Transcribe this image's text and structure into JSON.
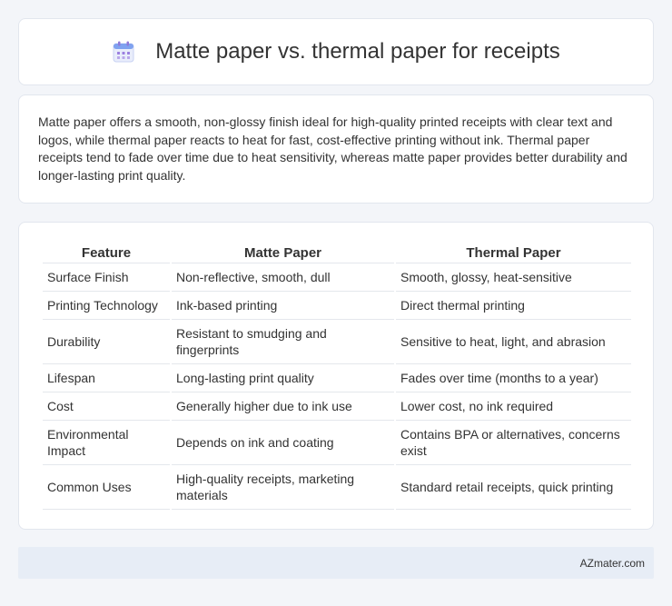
{
  "header": {
    "icon": "calendar-icon",
    "title": "Matte paper vs. thermal paper for receipts"
  },
  "summary": {
    "text": "Matte paper offers a smooth, non-glossy finish ideal for high-quality printed receipts with clear text and logos, while thermal paper reacts to heat for fast, cost-effective printing without ink. Thermal paper receipts tend to fade over time due to heat sensitivity, whereas matte paper provides better durability and longer-lasting print quality."
  },
  "table": {
    "headers": [
      "Feature",
      "Matte Paper",
      "Thermal Paper"
    ],
    "rows": [
      [
        "Surface Finish",
        "Non-reflective, smooth, dull",
        "Smooth, glossy, heat-sensitive"
      ],
      [
        "Printing Technology",
        "Ink-based printing",
        "Direct thermal printing"
      ],
      [
        "Durability",
        "Resistant to smudging and fingerprints",
        "Sensitive to heat, light, and abrasion"
      ],
      [
        "Lifespan",
        "Long-lasting print quality",
        "Fades over time (months to a year)"
      ],
      [
        "Cost",
        "Generally higher due to ink use",
        "Lower cost, no ink required"
      ],
      [
        "Environmental Impact",
        "Depends on ink and coating",
        "Contains BPA or alternatives, concerns exist"
      ],
      [
        "Common Uses",
        "High-quality receipts, marketing materials",
        "Standard retail receipts, quick printing"
      ]
    ]
  },
  "footer": {
    "text": "AZmater.com"
  },
  "colors": {
    "background": "#f3f5f9",
    "card": "#ffffff",
    "footer_bg": "#e7edf6",
    "icon_blue": "#5b8def",
    "icon_purple": "#9b7fe0"
  }
}
